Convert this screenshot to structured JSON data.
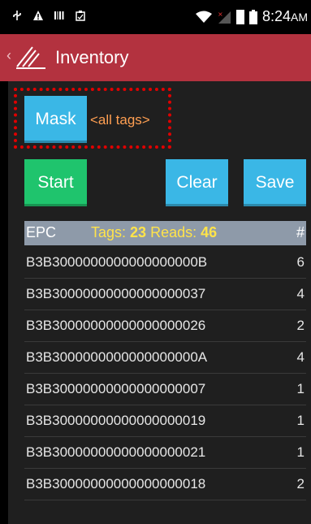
{
  "status_bar": {
    "time": "8:24",
    "time_suffix": "AM",
    "icons": [
      "usb-icon",
      "warning-icon",
      "barcode-icon",
      "clipboard-icon",
      "wifi-icon",
      "signal-icon",
      "battery-icon"
    ]
  },
  "app_bar": {
    "title": "Inventory",
    "back_glyph": "‹"
  },
  "mask": {
    "button_label": "Mask",
    "value": "<all tags>"
  },
  "actions": {
    "start_label": "Start",
    "clear_label": "Clear",
    "save_label": "Save"
  },
  "table": {
    "col_epc": "EPC",
    "tags_label": "Tags:",
    "tags_count": "23",
    "reads_label": "Reads:",
    "reads_count": "46",
    "col_count": "#",
    "rows": [
      {
        "epc": "B3B3000000000000000000B",
        "count": "6"
      },
      {
        "epc": "B3B30000000000000000037",
        "count": "4"
      },
      {
        "epc": "B3B30000000000000000026",
        "count": "2"
      },
      {
        "epc": "B3B3000000000000000000A",
        "count": "4"
      },
      {
        "epc": "B3B30000000000000000007",
        "count": "1"
      },
      {
        "epc": "B3B30000000000000000019",
        "count": "1"
      },
      {
        "epc": "B3B30000000000000000021",
        "count": "1"
      },
      {
        "epc": "B3B30000000000000000018",
        "count": "2"
      }
    ]
  },
  "colors": {
    "app_bar": "#b3323f",
    "button_blue": "#3ab7e6",
    "button_green": "#1fc46d",
    "header_bg": "#8e9aa9",
    "highlight_yellow": "#ffe34a",
    "mask_text": "#ff9f52",
    "annotation_red": "#e00000"
  }
}
